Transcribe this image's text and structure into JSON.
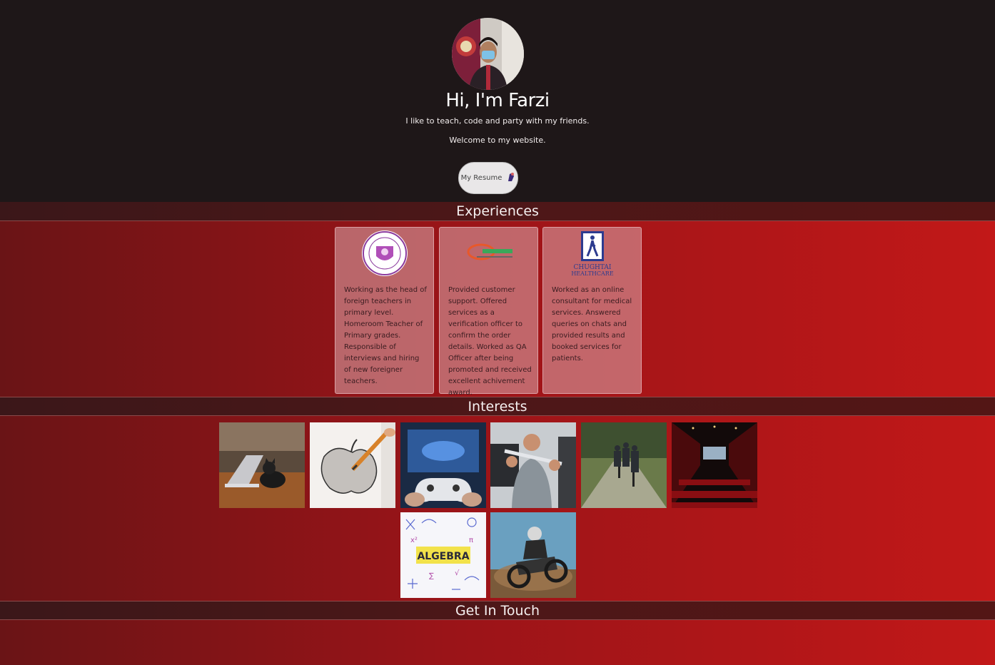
{
  "hero": {
    "heading": "Hi, I'm Farzi",
    "tagline": "I like to teach, code and party with my friends.",
    "welcome": "Welcome to my website.",
    "resume_label": "My Resume"
  },
  "sections": {
    "experiences": "Experiences",
    "interests": "Interests",
    "get_in_touch": "Get In Touch"
  },
  "experiences": [
    {
      "logo": "school-seal-logo",
      "description": "Working as the head of foreign teachers in primary level. Homeroom Teacher of Primary grades. Responsible of interviews and hiring of new foreigner teachers."
    },
    {
      "logo": "company-logo",
      "description": "Provided customer support. Offered services as a verification officer to confirm the order details. Worked as QA Officer after being promoted and received excellent achivement award."
    },
    {
      "logo": "chughtai-healthcare-logo",
      "logo_text_1": "CHUGHTAI",
      "logo_text_2": "HEALTHCARE",
      "description": "Worked as an online consultant for medical services. Answered queries on chats and provided results and booked services for patients."
    }
  ],
  "interests": [
    "cat-laptop-image",
    "apple-sketch-image",
    "gaming-controller-image",
    "gym-workout-image",
    "hiking-image",
    "cinema-image",
    "algebra-math-image",
    "motocross-image"
  ],
  "colors": {
    "hero_bg": "#1e1718",
    "section_bar": "#4d1718",
    "page_gradient_start": "#6a1416",
    "page_gradient_end": "#c21818"
  }
}
